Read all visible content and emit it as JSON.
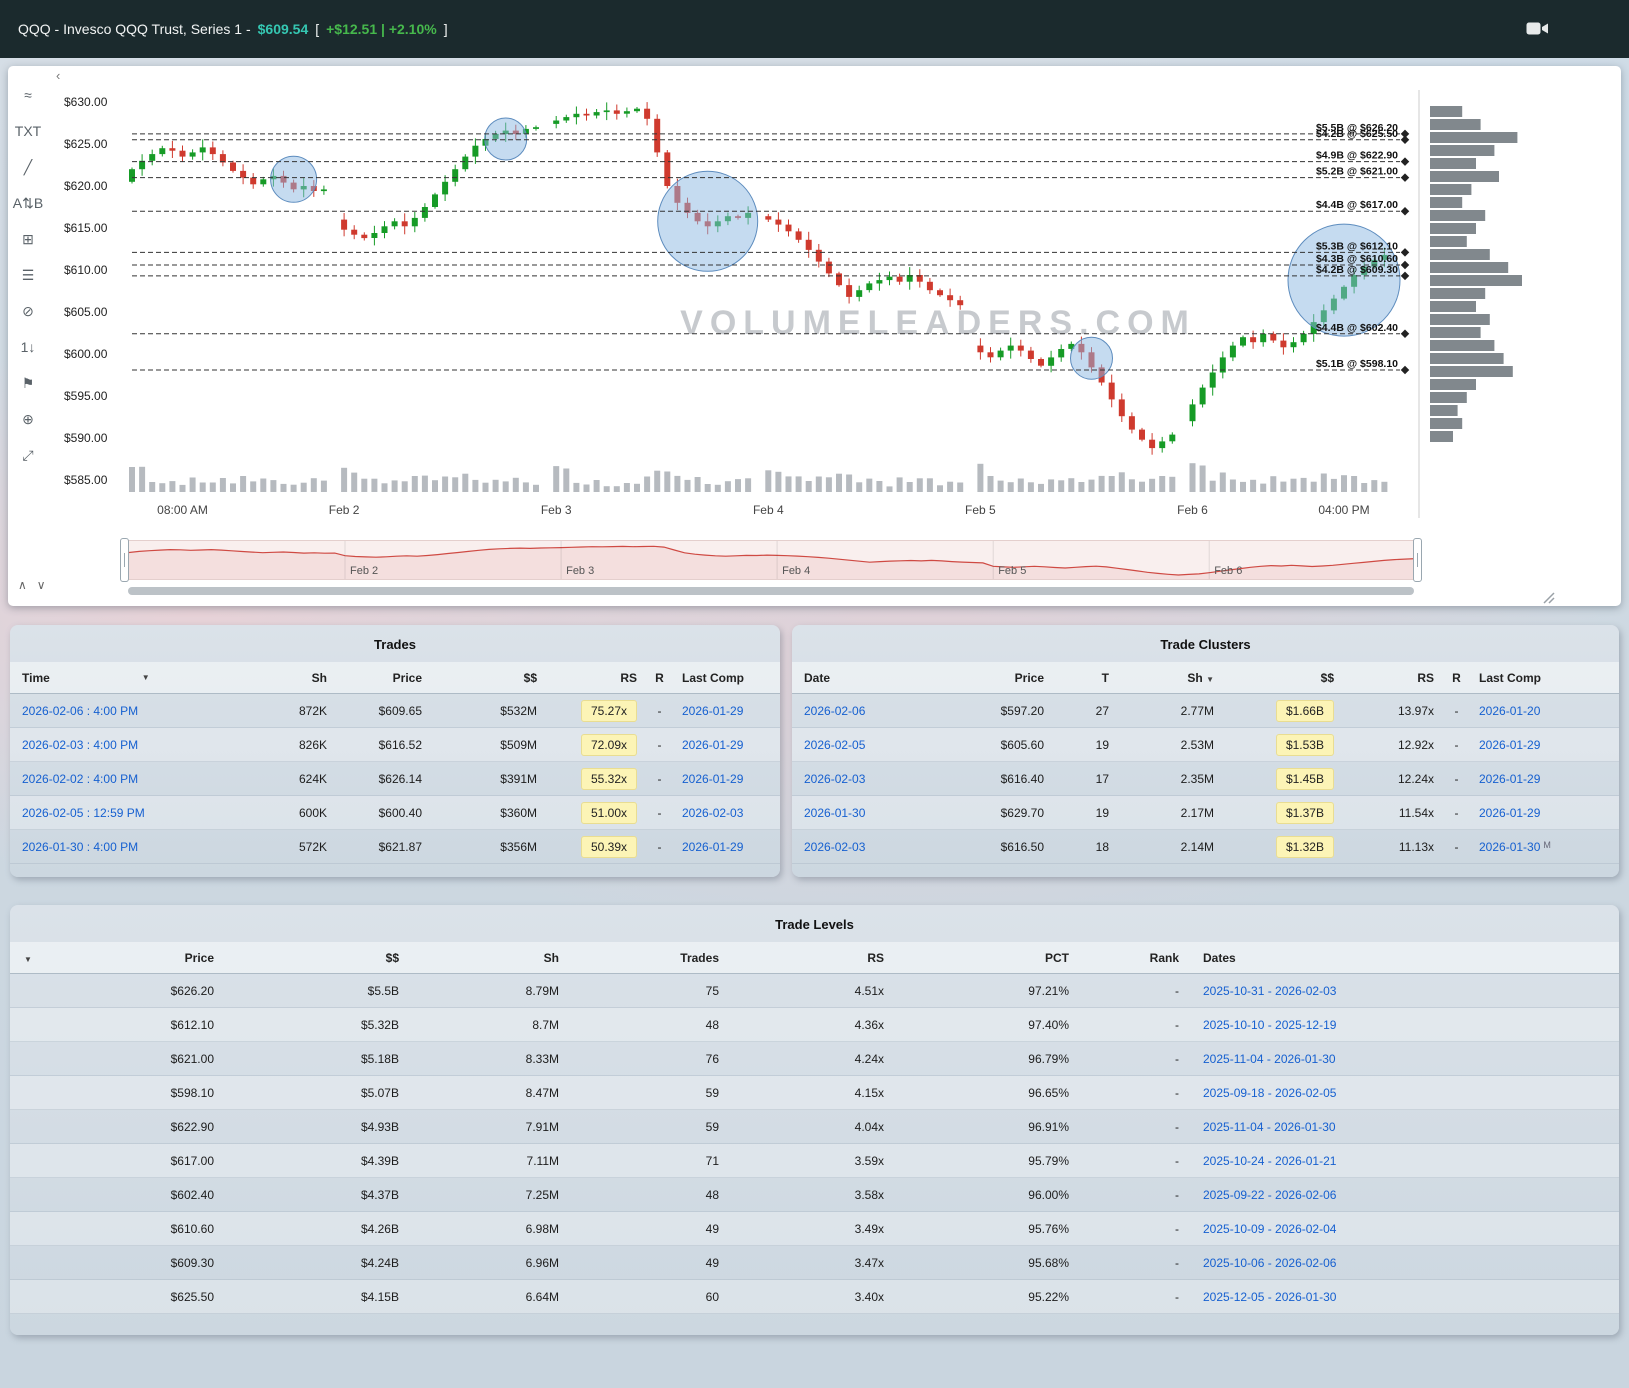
{
  "header": {
    "symbol_title": "QQQ - Invesco QQQ Trust, Series 1 -",
    "price": "$609.54",
    "bracket_open": "[",
    "change": "+$12.51 | +2.10%",
    "bracket_close": "]"
  },
  "toolbar": {
    "items": [
      {
        "name": "trend-tool-icon",
        "glyph": "≈"
      },
      {
        "name": "text-tool-icon",
        "glyph": "TXT"
      },
      {
        "name": "trendline-tool-icon",
        "glyph": "╱"
      },
      {
        "name": "ab-range-tool-icon",
        "glyph": "A⇅B"
      },
      {
        "name": "pattern-box-tool-icon",
        "glyph": "⊞"
      },
      {
        "name": "levels-rows-tool-icon",
        "glyph": "☰"
      },
      {
        "name": "hide-drawings-icon",
        "glyph": "⊘"
      },
      {
        "name": "numbers-tool-icon",
        "glyph": "1↓"
      },
      {
        "name": "flag-tool-icon",
        "glyph": "⚑"
      },
      {
        "name": "magnet-tool-icon",
        "glyph": "⊕"
      },
      {
        "name": "fullscreen-icon",
        "glyph": "⤢"
      }
    ]
  },
  "chart": {
    "watermark": "VOLUMELEADERS.COM",
    "y_axis_labels": [
      "$630.00",
      "$625.00",
      "$620.00",
      "$615.00",
      "$610.00",
      "$605.00",
      "$600.00",
      "$595.00",
      "$590.00",
      "$585.00"
    ],
    "x_axis_labels": [
      {
        "label": "08:00 AM",
        "pos": 5
      },
      {
        "label": "Feb 2",
        "pos": 21
      },
      {
        "label": "Feb 3",
        "pos": 42
      },
      {
        "label": "Feb 4",
        "pos": 63
      },
      {
        "label": "Feb 5",
        "pos": 84
      },
      {
        "label": "Feb 6",
        "pos": 105
      },
      {
        "label": "04:00 PM",
        "pos": 120
      }
    ],
    "navigator_labels": [
      "Feb 2",
      "Feb 3",
      "Feb 4",
      "Feb 5",
      "Feb 6"
    ],
    "price_path": [
      620.5,
      622.0,
      623.0,
      623.8,
      624.5,
      624.2,
      623.5,
      624.0,
      624.6,
      623.8,
      622.8,
      621.8,
      621.0,
      620.2,
      620.8,
      621.2,
      620.4,
      619.6,
      620.0,
      619.4,
      619.6,
      616.0,
      614.8,
      614.2,
      613.8,
      614.4,
      615.2,
      615.8,
      615.2,
      616.2,
      617.5,
      619.0,
      620.5,
      622.0,
      623.5,
      624.8,
      625.6,
      626.2,
      626.6,
      626.2,
      626.8,
      627.0,
      627.4,
      627.8,
      628.2,
      628.6,
      628.4,
      628.8,
      629.0,
      628.6,
      628.9,
      629.2,
      628.0,
      624.0,
      620.0,
      618.0,
      616.8,
      615.8,
      615.2,
      615.8,
      616.4,
      616.2,
      616.8,
      616.4,
      616.0,
      615.4,
      614.6,
      613.6,
      612.4,
      611.0,
      609.6,
      608.2,
      606.8,
      607.6,
      608.4,
      608.8,
      609.2,
      608.6,
      609.4,
      608.6,
      607.6,
      607.0,
      606.4,
      605.8,
      601.0,
      600.2,
      599.6,
      600.4,
      601.0,
      600.4,
      599.4,
      598.6,
      599.6,
      600.6,
      601.2,
      600.2,
      598.4,
      596.6,
      594.6,
      592.6,
      591.0,
      589.8,
      588.8,
      589.6,
      590.4,
      592.0,
      594.0,
      596.0,
      597.8,
      599.6,
      601.0,
      602.0,
      601.4,
      602.4,
      601.6,
      600.8,
      601.4,
      602.4,
      603.8,
      605.2,
      606.6,
      608.0,
      609.4,
      610.4,
      611.2,
      611.8
    ],
    "levels": [
      {
        "label": "$5.5B @ $626.20",
        "price": 626.2
      },
      {
        "label": "$4.2B @ $625.50",
        "price": 625.5
      },
      {
        "label": "$4.9B @ $622.90",
        "price": 622.9
      },
      {
        "label": "$5.2B @ $621.00",
        "price": 621.0
      },
      {
        "label": "$4.4B @ $617.00",
        "price": 617.0
      },
      {
        "label": "$5.3B @ $612.10",
        "price": 612.1
      },
      {
        "label": "$4.3B @ $610.60",
        "price": 610.6
      },
      {
        "label": "$4.2B @ $609.30",
        "price": 609.3
      },
      {
        "label": "$4.4B @ $602.40",
        "price": 602.4
      },
      {
        "label": "$5.1B @ $598.10",
        "price": 598.1
      }
    ],
    "bubbles": [
      {
        "index": 16,
        "price": 620.8,
        "r": 23
      },
      {
        "index": 37,
        "price": 625.6,
        "r": 21
      },
      {
        "index": 57,
        "price": 615.8,
        "r": 50
      },
      {
        "index": 95,
        "price": 599.5,
        "r": 21
      },
      {
        "index": 120,
        "price": 608.8,
        "r": 56
      }
    ],
    "volume_profile": [
      0.35,
      0.55,
      0.95,
      0.7,
      0.5,
      0.75,
      0.45,
      0.35,
      0.6,
      0.5,
      0.4,
      0.65,
      0.85,
      1.0,
      0.6,
      0.5,
      0.65,
      0.55,
      0.7,
      0.8,
      0.9,
      0.5,
      0.4,
      0.3,
      0.35,
      0.25
    ]
  },
  "trades": {
    "title": "Trades",
    "columns": [
      "Time",
      "Sh",
      "Price",
      "$$",
      "RS",
      "R",
      "Last Comp"
    ],
    "rows": [
      {
        "time": "2026-02-06 : 4:00 PM",
        "sh": "872K",
        "price": "$609.65",
        "dollars": "$532M",
        "rs": "75.27x",
        "r": "-",
        "last_comp": "2026-01-29"
      },
      {
        "time": "2026-02-03 : 4:00 PM",
        "sh": "826K",
        "price": "$616.52",
        "dollars": "$509M",
        "rs": "72.09x",
        "r": "-",
        "last_comp": "2026-01-29"
      },
      {
        "time": "2026-02-02 : 4:00 PM",
        "sh": "624K",
        "price": "$626.14",
        "dollars": "$391M",
        "rs": "55.32x",
        "r": "-",
        "last_comp": "2026-01-29"
      },
      {
        "time": "2026-02-05 : 12:59 PM",
        "sh": "600K",
        "price": "$600.40",
        "dollars": "$360M",
        "rs": "51.00x",
        "r": "-",
        "last_comp": "2026-02-03"
      },
      {
        "time": "2026-01-30 : 4:00 PM",
        "sh": "572K",
        "price": "$621.87",
        "dollars": "$356M",
        "rs": "50.39x",
        "r": "-",
        "last_comp": "2026-01-29"
      }
    ]
  },
  "clusters": {
    "title": "Trade Clusters",
    "columns": [
      "Date",
      "Price",
      "T",
      "Sh",
      "$$",
      "RS",
      "R",
      "Last Comp"
    ],
    "rows": [
      {
        "date": "2026-02-06",
        "price": "$597.20",
        "t": "27",
        "sh": "2.77M",
        "dollars": "$1.66B",
        "rs": "13.97x",
        "r": "-",
        "last_comp": "2026-01-20",
        "suffix": ""
      },
      {
        "date": "2026-02-05",
        "price": "$605.60",
        "t": "19",
        "sh": "2.53M",
        "dollars": "$1.53B",
        "rs": "12.92x",
        "r": "-",
        "last_comp": "2026-01-29",
        "suffix": ""
      },
      {
        "date": "2026-02-03",
        "price": "$616.40",
        "t": "17",
        "sh": "2.35M",
        "dollars": "$1.45B",
        "rs": "12.24x",
        "r": "-",
        "last_comp": "2026-01-29",
        "suffix": ""
      },
      {
        "date": "2026-01-30",
        "price": "$629.70",
        "t": "19",
        "sh": "2.17M",
        "dollars": "$1.37B",
        "rs": "11.54x",
        "r": "-",
        "last_comp": "2026-01-29",
        "suffix": ""
      },
      {
        "date": "2026-02-03",
        "price": "$616.50",
        "t": "18",
        "sh": "2.14M",
        "dollars": "$1.32B",
        "rs": "11.13x",
        "r": "-",
        "last_comp": "2026-01-30",
        "suffix": "M"
      }
    ]
  },
  "levels_table": {
    "title": "Trade Levels",
    "columns": [
      "Price",
      "$$",
      "Sh",
      "Trades",
      "RS",
      "PCT",
      "Rank",
      "Dates"
    ],
    "rows": [
      {
        "price": "$626.20",
        "dollars": "$5.5B",
        "sh": "8.79M",
        "trades": "75",
        "rs": "4.51x",
        "pct": "97.21%",
        "rank": "-",
        "dates": "2025-10-31 - 2026-02-03"
      },
      {
        "price": "$612.10",
        "dollars": "$5.32B",
        "sh": "8.7M",
        "trades": "48",
        "rs": "4.36x",
        "pct": "97.40%",
        "rank": "-",
        "dates": "2025-10-10 - 2025-12-19"
      },
      {
        "price": "$621.00",
        "dollars": "$5.18B",
        "sh": "8.33M",
        "trades": "76",
        "rs": "4.24x",
        "pct": "96.79%",
        "rank": "-",
        "dates": "2025-11-04 - 2026-01-30"
      },
      {
        "price": "$598.10",
        "dollars": "$5.07B",
        "sh": "8.47M",
        "trades": "59",
        "rs": "4.15x",
        "pct": "96.65%",
        "rank": "-",
        "dates": "2025-09-18 - 2026-02-05"
      },
      {
        "price": "$622.90",
        "dollars": "$4.93B",
        "sh": "7.91M",
        "trades": "59",
        "rs": "4.04x",
        "pct": "96.91%",
        "rank": "-",
        "dates": "2025-11-04 - 2026-01-30"
      },
      {
        "price": "$617.00",
        "dollars": "$4.39B",
        "sh": "7.11M",
        "trades": "71",
        "rs": "3.59x",
        "pct": "95.79%",
        "rank": "-",
        "dates": "2025-10-24 - 2026-01-21"
      },
      {
        "price": "$602.40",
        "dollars": "$4.37B",
        "sh": "7.25M",
        "trades": "48",
        "rs": "3.58x",
        "pct": "96.00%",
        "rank": "-",
        "dates": "2025-09-22 - 2026-02-06"
      },
      {
        "price": "$610.60",
        "dollars": "$4.26B",
        "sh": "6.98M",
        "trades": "49",
        "rs": "3.49x",
        "pct": "95.76%",
        "rank": "-",
        "dates": "2025-10-09 - 2026-02-04"
      },
      {
        "price": "$609.30",
        "dollars": "$4.24B",
        "sh": "6.96M",
        "trades": "49",
        "rs": "3.47x",
        "pct": "95.68%",
        "rank": "-",
        "dates": "2025-10-06 - 2026-02-06"
      },
      {
        "price": "$625.50",
        "dollars": "$4.15B",
        "sh": "6.64M",
        "trades": "60",
        "rs": "3.40x",
        "pct": "95.22%",
        "rank": "-",
        "dates": "2025-12-05 - 2026-01-30"
      }
    ]
  }
}
